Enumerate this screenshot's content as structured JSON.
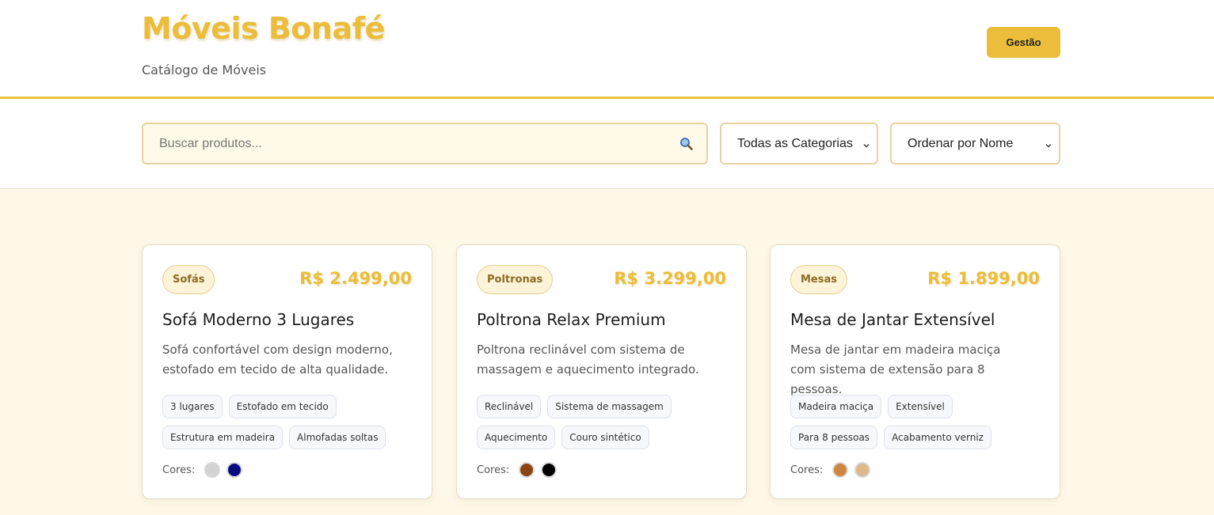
{
  "header": {
    "title": "Móveis Bonafé",
    "subtitle": "Catálogo de Móveis",
    "gestao_label": "Gestão"
  },
  "filters": {
    "search_placeholder": "Buscar produtos...",
    "category_selected": "Todas as Categorias",
    "sort_selected": "Ordenar por Nome"
  },
  "colors_label": "Cores:",
  "products": [
    {
      "category": "Sofás",
      "price": "R$ 2.499,00",
      "name": "Sofá Moderno 3 Lugares",
      "description": "Sofá confortável com design moderno, estofado em tecido de alta qualidade.",
      "features": [
        "3 lugares",
        "Estofado em tecido",
        "Estrutura em madeira",
        "Almofadas soltas"
      ],
      "colors": [
        "#d3d3d3",
        "#0a0a80"
      ]
    },
    {
      "category": "Poltronas",
      "price": "R$ 3.299,00",
      "name": "Poltrona Relax Premium",
      "description": "Poltrona reclinável com sistema de massagem e aquecimento integrado.",
      "features": [
        "Reclinável",
        "Sistema de massagem",
        "Aquecimento",
        "Couro sintético"
      ],
      "colors": [
        "#8b4513",
        "#000000"
      ]
    },
    {
      "category": "Mesas",
      "price": "R$ 1.899,00",
      "name": "Mesa de Jantar Extensível",
      "description": "Mesa de jantar em madeira maciça com sistema de extensão para 8 pessoas.",
      "features": [
        "Madeira maciça",
        "Extensível",
        "Para 8 pessoas",
        "Acabamento verniz"
      ],
      "colors": [
        "#cd853f",
        "#deb887"
      ]
    }
  ]
}
